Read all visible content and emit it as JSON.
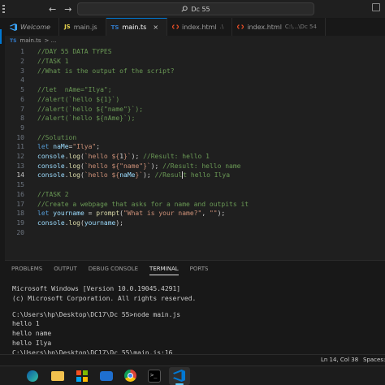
{
  "window": {
    "search_text": "Dc 55"
  },
  "tabs": [
    {
      "icon": "vscode-icon",
      "label": "Welcome",
      "hint": "",
      "active": false
    },
    {
      "icon": "js-file-icon",
      "label": "main.js",
      "hint": "",
      "active": false
    },
    {
      "icon": "ts-file-icon",
      "label": "main.ts",
      "hint": "",
      "active": true
    },
    {
      "icon": "html-file-icon",
      "label": "index.html",
      "hint": ".\\",
      "active": false
    },
    {
      "icon": "html-file-icon",
      "label": "index.html",
      "hint": "C:\\...\\Dc 54",
      "active": false
    }
  ],
  "icons": {
    "js_badge": "JS",
    "ts_badge": "TS",
    "close": "×",
    "back": "←",
    "forward": "→"
  },
  "breadcrumb": {
    "badge": "TS",
    "file": "main.ts",
    "rest": "> ..."
  },
  "editor": {
    "current_line": 14,
    "lines": [
      {
        "n": "1",
        "tokens": [
          {
            "c": "cm",
            "t": "//DAY 55 DATA TYPES"
          }
        ]
      },
      {
        "n": "2",
        "tokens": [
          {
            "c": "cm",
            "t": "//TASK 1"
          }
        ]
      },
      {
        "n": "3",
        "tokens": [
          {
            "c": "cm",
            "t": "//What is the output of the script?"
          }
        ]
      },
      {
        "n": "4",
        "tokens": []
      },
      {
        "n": "5",
        "tokens": [
          {
            "c": "cm",
            "t": "//let  nAme=\"Ilya\";"
          }
        ]
      },
      {
        "n": "6",
        "tokens": [
          {
            "c": "cm",
            "t": "//alert(`hello ${1}`)"
          }
        ]
      },
      {
        "n": "7",
        "tokens": [
          {
            "c": "cm",
            "t": "//alert(`hello ${\"name\"}`);"
          }
        ]
      },
      {
        "n": "8",
        "tokens": [
          {
            "c": "cm",
            "t": "//alert(`hello ${nAme}`);"
          }
        ]
      },
      {
        "n": "9",
        "tokens": []
      },
      {
        "n": "10",
        "tokens": [
          {
            "c": "cm",
            "t": "//Solution"
          }
        ]
      },
      {
        "n": "11",
        "tokens": [
          {
            "c": "kw",
            "t": "let "
          },
          {
            "c": "var",
            "t": "naMe"
          },
          {
            "c": "pl",
            "t": "="
          },
          {
            "c": "str",
            "t": "\"Ilya\""
          },
          {
            "c": "pl",
            "t": ";"
          }
        ]
      },
      {
        "n": "12",
        "tokens": [
          {
            "c": "var",
            "t": "console"
          },
          {
            "c": "pl",
            "t": "."
          },
          {
            "c": "fn",
            "t": "log"
          },
          {
            "c": "pl",
            "t": "("
          },
          {
            "c": "str",
            "t": "`hello ${"
          },
          {
            "c": "pl",
            "t": "1"
          },
          {
            "c": "str",
            "t": "}`"
          },
          {
            "c": "pl",
            "t": "); "
          },
          {
            "c": "cm",
            "t": "//Result: hello 1"
          }
        ]
      },
      {
        "n": "13",
        "tokens": [
          {
            "c": "var",
            "t": "console"
          },
          {
            "c": "pl",
            "t": "."
          },
          {
            "c": "fn",
            "t": "log"
          },
          {
            "c": "pl",
            "t": "("
          },
          {
            "c": "str",
            "t": "`hello ${\"name\"}`"
          },
          {
            "c": "pl",
            "t": "); "
          },
          {
            "c": "cm",
            "t": "//Result: hello name"
          }
        ]
      },
      {
        "n": "14",
        "tokens": [
          {
            "c": "var",
            "t": "console"
          },
          {
            "c": "pl",
            "t": "."
          },
          {
            "c": "fn",
            "t": "log"
          },
          {
            "c": "pl",
            "t": "("
          },
          {
            "c": "str",
            "t": "`hello ${"
          },
          {
            "c": "var",
            "t": "naMe"
          },
          {
            "c": "str",
            "t": "}`"
          },
          {
            "c": "pl",
            "t": "); "
          },
          {
            "c": "cm",
            "t": "//Resul"
          },
          {
            "c": "cursor",
            "t": ""
          },
          {
            "c": "cm",
            "t": "t hello Ilya"
          }
        ]
      },
      {
        "n": "15",
        "tokens": []
      },
      {
        "n": "16",
        "tokens": [
          {
            "c": "cm",
            "t": "//TASK 2"
          }
        ]
      },
      {
        "n": "17",
        "tokens": [
          {
            "c": "cm",
            "t": "//Create a webpage that asks for a name and outpits it"
          }
        ]
      },
      {
        "n": "18",
        "tokens": [
          {
            "c": "kw",
            "t": "let "
          },
          {
            "c": "var",
            "t": "yourname"
          },
          {
            "c": "pl",
            "t": " = "
          },
          {
            "c": "fn",
            "t": "prompt"
          },
          {
            "c": "pl",
            "t": "("
          },
          {
            "c": "str",
            "t": "\"What is your name?\""
          },
          {
            "c": "pl",
            "t": ", "
          },
          {
            "c": "str",
            "t": "\"\""
          },
          {
            "c": "pl",
            "t": ");"
          }
        ]
      },
      {
        "n": "19",
        "tokens": [
          {
            "c": "var",
            "t": "console"
          },
          {
            "c": "pl",
            "t": "."
          },
          {
            "c": "fn",
            "t": "log"
          },
          {
            "c": "pl",
            "t": "("
          },
          {
            "c": "var",
            "t": "yourname"
          },
          {
            "c": "pl",
            "t": ");"
          }
        ]
      },
      {
        "n": "20",
        "tokens": []
      }
    ]
  },
  "panel": {
    "tabs": [
      {
        "label": "PROBLEMS",
        "active": false
      },
      {
        "label": "OUTPUT",
        "active": false
      },
      {
        "label": "DEBUG CONSOLE",
        "active": false
      },
      {
        "label": "TERMINAL",
        "active": true
      },
      {
        "label": "PORTS",
        "active": false
      }
    ],
    "terminal_lines": [
      "Microsoft Windows [Version 10.0.19045.4291]",
      "(c) Microsoft Corporation. All rights reserved.",
      "",
      "C:\\Users\\hp\\Desktop\\DC17\\Dc 55>node main.js",
      "hello 1",
      "hello name",
      "hello Ilya",
      "C:\\Users\\hp\\Desktop\\DC17\\Dc 55\\main.js:16"
    ]
  },
  "status": {
    "position": "Ln 14, Col 38",
    "spaces": "Spaces:"
  }
}
